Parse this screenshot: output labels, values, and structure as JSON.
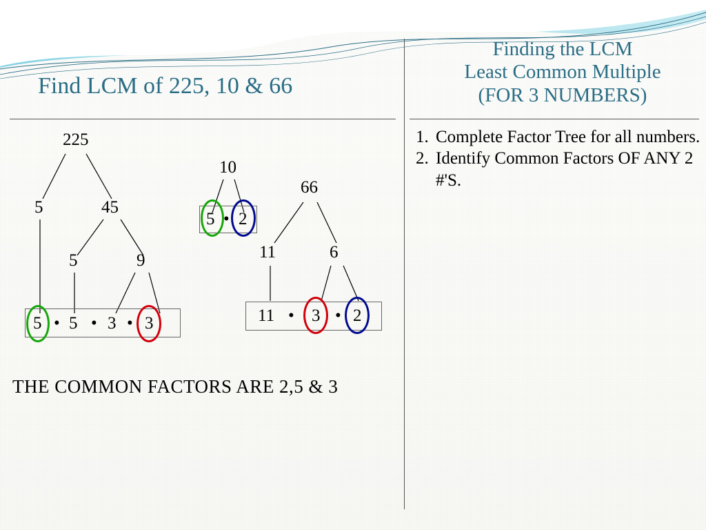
{
  "header": {
    "main_title": "Find LCM of 225, 10 & 66",
    "right_title_line1": "Finding the LCM",
    "right_title_line2": "Least Common Multiple",
    "right_title_line3": "(FOR 3 NUMBERS)"
  },
  "steps": {
    "s1": "Complete Factor Tree for all numbers.",
    "s2": "Identify Common Factors OF ANY 2 #'S."
  },
  "tree225": {
    "root": "225",
    "l1a": "5",
    "l1b": "45",
    "l2a": "5",
    "l2b": "9",
    "factors": {
      "a": "5",
      "b": "5",
      "c": "3",
      "d": "3"
    }
  },
  "tree10": {
    "root": "10",
    "factors": {
      "a": "5",
      "b": "2"
    }
  },
  "tree66": {
    "root": "66",
    "l1a": "11",
    "l1b": "6",
    "factors": {
      "a": "11",
      "b": "3",
      "c": "2"
    }
  },
  "common_text": "THE COMMON FACTORS ARE 2,5 & 3",
  "colors": {
    "green": "#17a60b",
    "blue": "#000a8e",
    "red": "#d1000a"
  }
}
